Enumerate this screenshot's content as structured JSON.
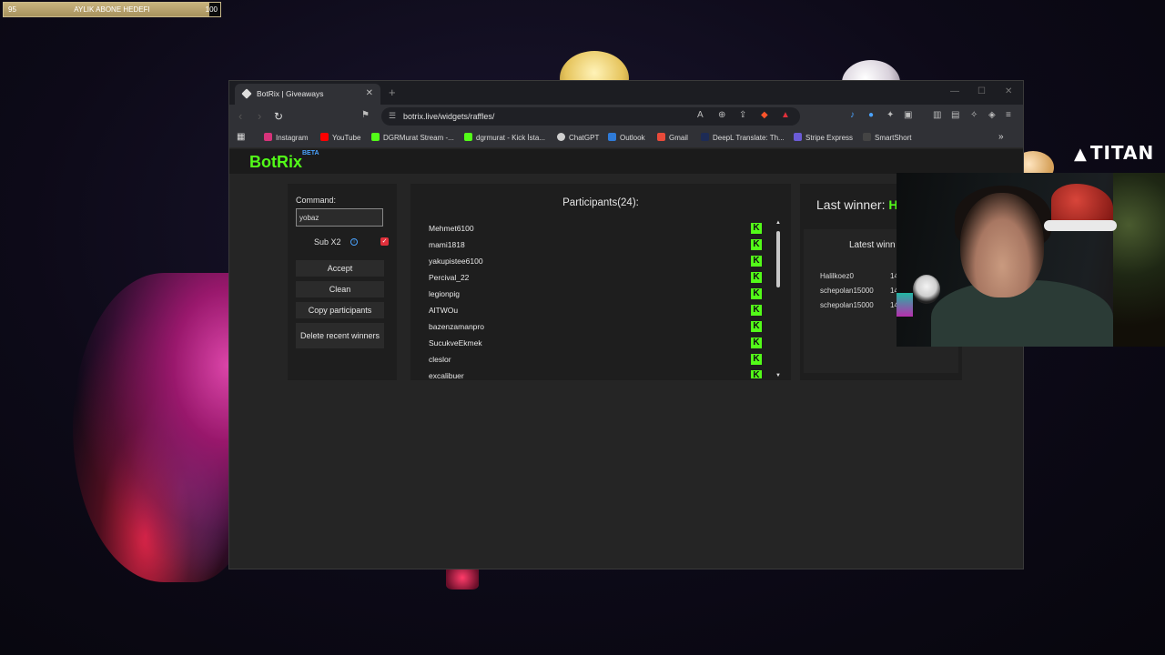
{
  "overlay": {
    "sub_goal": {
      "current": "95",
      "title": "AYLIK ABONE HEDEFI",
      "target": "100",
      "progress": 0.95
    },
    "brand_logo": "TITAN"
  },
  "browser": {
    "tab_title": "BotRix | Giveaways",
    "url": "botrix.live/widgets/raffles/",
    "bookmarks": [
      {
        "label": "Instagram",
        "icon": "instagram-icon",
        "color": "#d6337a"
      },
      {
        "label": "YouTube",
        "icon": "youtube-icon",
        "color": "#ff0000"
      },
      {
        "label": "DGRMurat Stream -...",
        "icon": "kick-icon",
        "color": "#53fc18"
      },
      {
        "label": "dgrmurat - Kick İsta...",
        "icon": "kick-icon",
        "color": "#53fc18"
      },
      {
        "label": "ChatGPT",
        "icon": "chatgpt-icon",
        "color": "#cfcfcf"
      },
      {
        "label": "Outlook",
        "icon": "outlook-icon",
        "color": "#2f7bd8"
      },
      {
        "label": "Gmail",
        "icon": "gmail-icon",
        "color": "#e84a3a"
      },
      {
        "label": "DeepL Translate: Th...",
        "icon": "deepl-icon",
        "color": "#1d2b55"
      },
      {
        "label": "Stripe Express",
        "icon": "stripe-icon",
        "color": "#6b5bd6"
      },
      {
        "label": "SmartShort",
        "icon": "link-icon",
        "color": "#888888"
      }
    ]
  },
  "botrix": {
    "brand": "BotRix",
    "brand_badge": "BETA",
    "command_label": "Command:",
    "command_value": "yobaz",
    "sub_label": "Sub X2",
    "buttons": {
      "accept": "Accept",
      "clean": "Clean",
      "copy": "Copy participants",
      "delete": "Delete recent winners"
    },
    "participants_title": "Participants(24):",
    "participants": [
      "Mehmet6100",
      "mami1818",
      "yakupistee6100",
      "Percival_22",
      "legionpig",
      "AlTWOu",
      "bazenzamanpro",
      "SucukveEkmek",
      "cleslor",
      "excalibuer"
    ],
    "last_winner_label": "Last winner:",
    "last_winner_name": "H",
    "latest_title": "Latest winn",
    "latest_winners": [
      {
        "name": "Halilkoez0",
        "time": "14"
      },
      {
        "name": "schepolan15000",
        "time": "14"
      },
      {
        "name": "schepolan15000",
        "time": "14"
      }
    ]
  }
}
